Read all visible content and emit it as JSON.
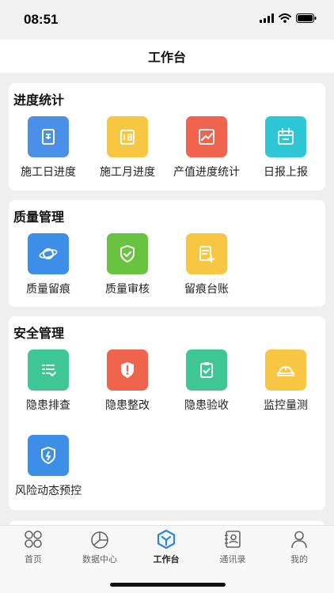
{
  "status_bar": {
    "time": "08:51",
    "icons": [
      "signal-icon",
      "wifi-icon",
      "battery-icon"
    ]
  },
  "nav": {
    "title": "工作台"
  },
  "sections": [
    {
      "title": "进度统计",
      "items": [
        {
          "label": "施工日进度",
          "icon": "daily-progress-icon",
          "color": "#4a90e8"
        },
        {
          "label": "施工月进度",
          "icon": "monthly-progress-icon",
          "color": "#f7c744"
        },
        {
          "label": "产值进度统计",
          "icon": "trend-chart-icon",
          "color": "#f0634c"
        },
        {
          "label": "日报上报",
          "icon": "calendar-icon",
          "color": "#2ec7d6"
        }
      ]
    },
    {
      "title": "质量管理",
      "items": [
        {
          "label": "质量留痕",
          "icon": "planet-icon",
          "color": "#3d8ee6"
        },
        {
          "label": "质量审核",
          "icon": "shield-check-icon",
          "color": "#6ac241"
        },
        {
          "label": "留痕台账",
          "icon": "document-add-icon",
          "color": "#f7c744"
        }
      ]
    },
    {
      "title": "安全管理",
      "items": [
        {
          "label": "隐患排查",
          "icon": "checklist-icon",
          "color": "#3ec695"
        },
        {
          "label": "隐患整改",
          "icon": "shield-alert-icon",
          "color": "#f0634c"
        },
        {
          "label": "隐患验收",
          "icon": "clipboard-check-icon",
          "color": "#3ec695"
        },
        {
          "label": "监控量测",
          "icon": "helmet-icon",
          "color": "#f7c744"
        },
        {
          "label": "风险动态预控",
          "icon": "shield-bolt-icon",
          "color": "#3d8ee6"
        }
      ]
    }
  ],
  "tabs": [
    {
      "label": "首页",
      "icon": "home-grid-icon",
      "active": false
    },
    {
      "label": "数据中心",
      "icon": "pie-chart-icon",
      "active": false
    },
    {
      "label": "工作台",
      "icon": "workbench-icon",
      "active": true
    },
    {
      "label": "通讯录",
      "icon": "contacts-icon",
      "active": false
    },
    {
      "label": "我的",
      "icon": "profile-icon",
      "active": false
    }
  ],
  "colors": {
    "accent": "#2a86e0",
    "background": "#efefef",
    "card": "#ffffff"
  }
}
